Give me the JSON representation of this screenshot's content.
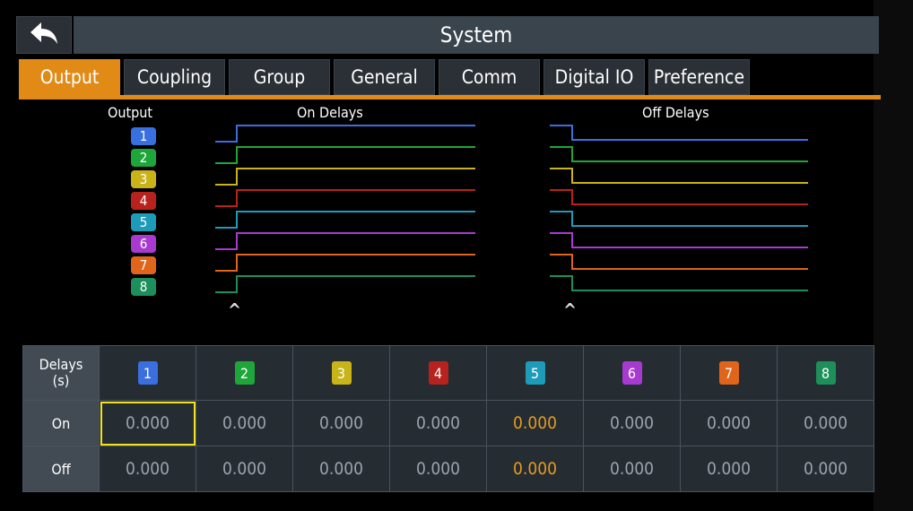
{
  "title": "System",
  "tabs": [
    {
      "label": "Output",
      "active": true
    },
    {
      "label": "Coupling",
      "active": false
    },
    {
      "label": "Group",
      "active": false
    },
    {
      "label": "General",
      "active": false
    },
    {
      "label": "Comm",
      "active": false
    },
    {
      "label": "Digital IO",
      "active": false
    },
    {
      "label": "Preference",
      "active": false
    }
  ],
  "diagram": {
    "output_label": "Output",
    "on_label": "On Delays",
    "off_label": "Off Delays",
    "channels": [
      {
        "label": "1",
        "color": "#3a6fe0"
      },
      {
        "label": "2",
        "color": "#1ea63a"
      },
      {
        "label": "3",
        "color": "#c8b418"
      },
      {
        "label": "4",
        "color": "#b8221e"
      },
      {
        "label": "5",
        "color": "#1e9bb8"
      },
      {
        "label": "6",
        "color": "#a83ad0"
      },
      {
        "label": "7",
        "color": "#e0641a"
      },
      {
        "label": "8",
        "color": "#1c8f5a"
      }
    ]
  },
  "table": {
    "header_label": "Delays\n(s)",
    "rows": [
      {
        "label": "On",
        "values": [
          "0.000",
          "0.000",
          "0.000",
          "0.000",
          "0.000",
          "0.000",
          "0.000",
          "0.000"
        ]
      },
      {
        "label": "Off",
        "values": [
          "0.000",
          "0.000",
          "0.000",
          "0.000",
          "0.000",
          "0.000",
          "0.000",
          "0.000"
        ]
      }
    ]
  }
}
